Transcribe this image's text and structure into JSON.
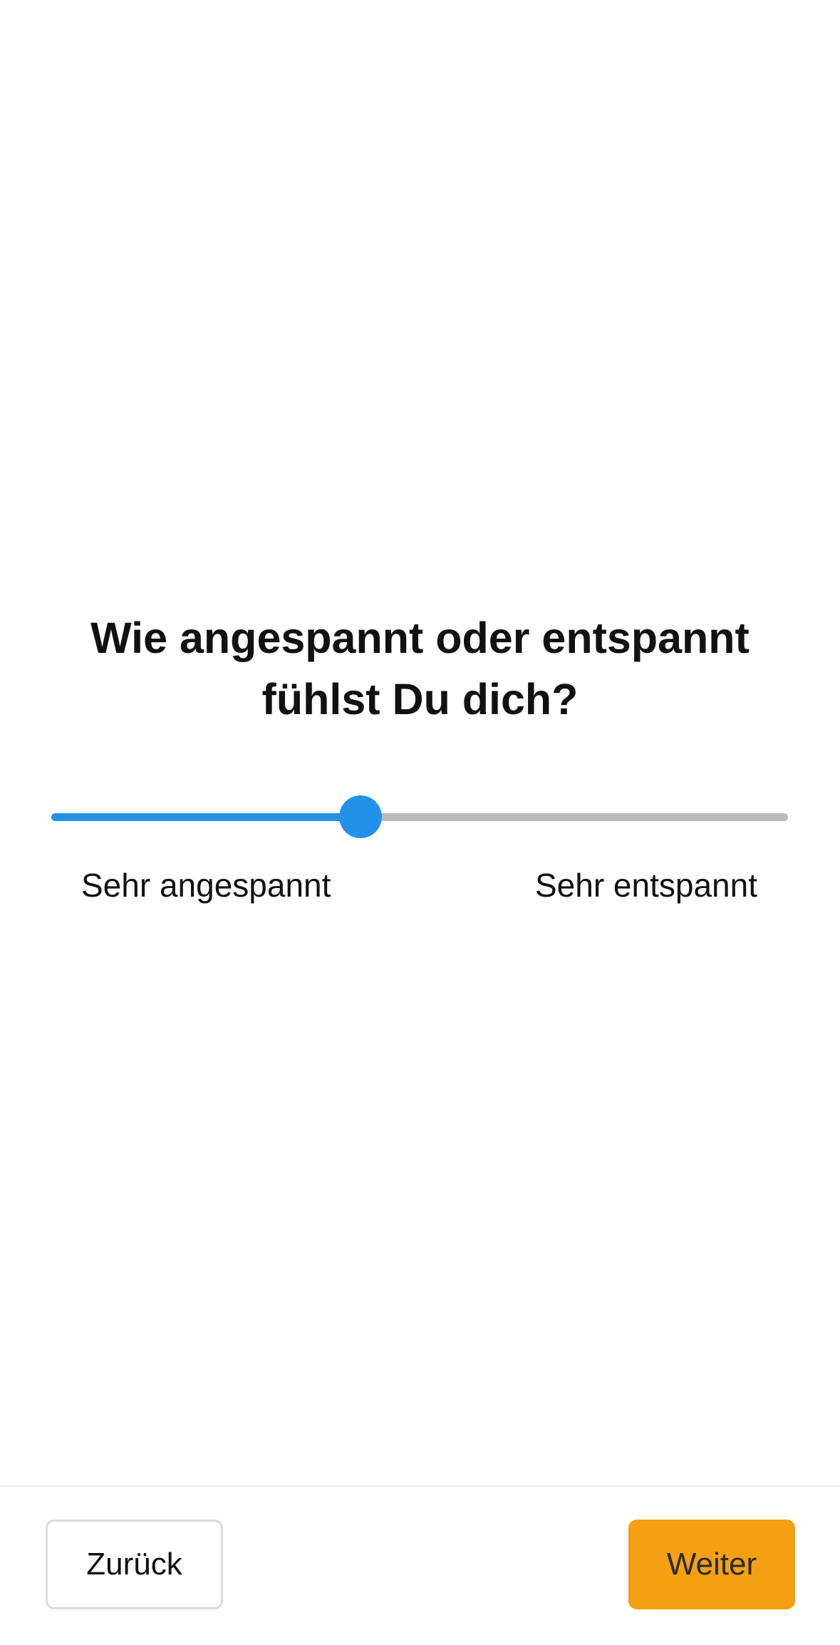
{
  "question": {
    "line1": "Wie angespannt oder entspannt",
    "line2": "fühlst Du dich?"
  },
  "slider": {
    "value_fraction": 0.42,
    "min_label": "Sehr angespannt",
    "max_label": "Sehr entspannt",
    "fill_color": "#2391e8",
    "track_color": "#b9b9b9"
  },
  "footer": {
    "back_label": "Zurück",
    "next_label": "Weiter",
    "next_color": "#f4a012"
  }
}
